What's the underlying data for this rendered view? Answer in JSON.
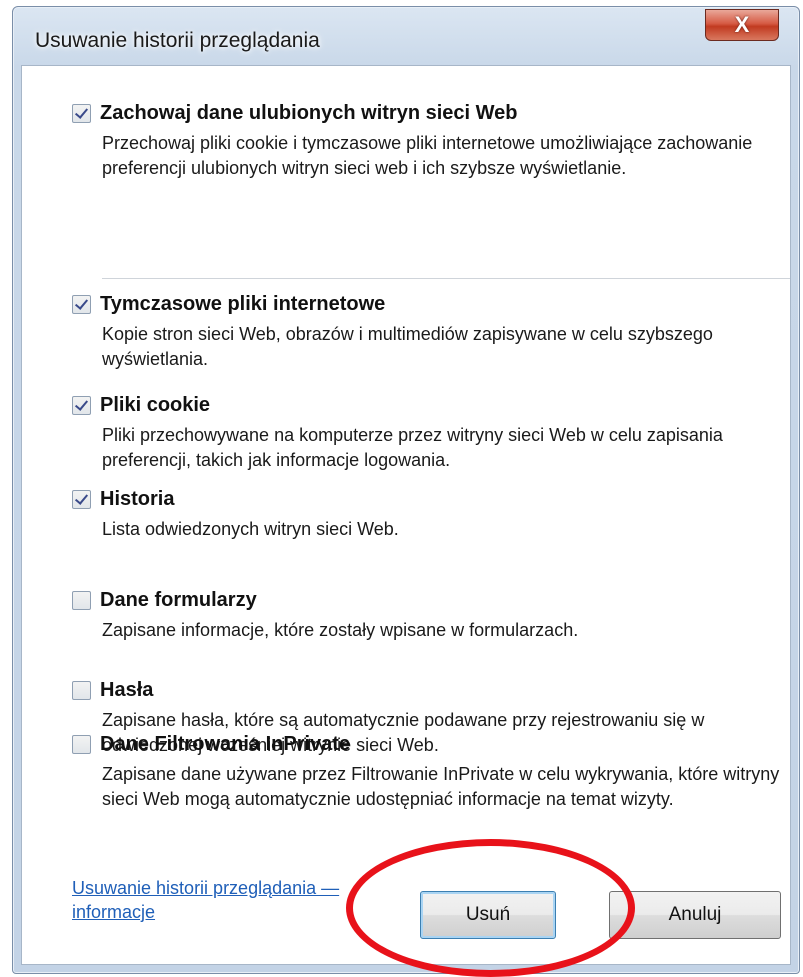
{
  "window": {
    "title": "Usuwanie historii przeglądania",
    "close_label": "X"
  },
  "options": [
    {
      "title": "Zachowaj dane ulubionych witryn sieci Web",
      "description": "Przechowaj pliki cookie i tymczasowe pliki internetowe umożliwiające zachowanie preferencji ulubionych witryn sieci web i ich szybsze wyświetlanie.",
      "checked": true
    },
    {
      "title": "Tymczasowe pliki internetowe",
      "description": "Kopie stron sieci Web, obrazów i multimediów zapisywane w celu szybszego wyświetlania.",
      "checked": true
    },
    {
      "title": "Pliki cookie",
      "description": "Pliki przechowywane na komputerze przez witryny sieci Web w celu zapisania preferencji, takich jak informacje logowania.",
      "checked": true
    },
    {
      "title": "Historia",
      "description": "Lista odwiedzonych witryn sieci Web.",
      "checked": true
    },
    {
      "title": "Dane formularzy",
      "description": "Zapisane informacje, które zostały wpisane w formularzach.",
      "checked": false
    },
    {
      "title": "Hasła",
      "description": "Zapisane hasła, które są automatycznie podawane przy rejestrowaniu się w odwiedzonej wcześniej witrynie sieci Web.",
      "checked": false
    },
    {
      "title": "Dane Filtrowania InPrivate",
      "description": "Zapisane dane używane przez Filtrowanie InPrivate w celu wykrywania, które witryny sieci Web mogą automatycznie udostępniać informacje na temat wizyty.",
      "checked": false
    }
  ],
  "footer": {
    "help_link": "Usuwanie historii przeglądania — informacje",
    "delete_label": "Usuń",
    "cancel_label": "Anuluj"
  },
  "colors": {
    "annotation": "#e8121a",
    "link": "#1f5fb8"
  }
}
